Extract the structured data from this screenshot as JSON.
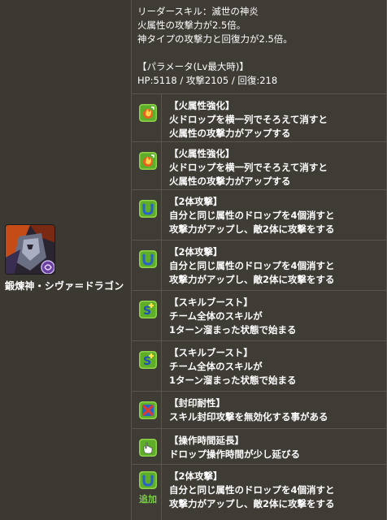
{
  "leader": {
    "lines": [
      "リーダースキル：滅世の神炎",
      "火属性の攻撃力が2.5倍。",
      "神タイプの攻撃力と回復力が2.5倍。",
      "",
      "【パラメータ(Lv最大時)】",
      "HP:5118 / 攻撃2105 / 回復:218"
    ]
  },
  "monster": {
    "name": "鍛煉神・シヴァ＝ドラゴン",
    "accent": "#c54c16"
  },
  "awakenings": [
    {
      "icon": "fire-enhance-icon",
      "title": "【火属性強化】",
      "lines": [
        "火ドロップを横一列でそろえて消すと",
        "火属性の攻撃力がアップする"
      ]
    },
    {
      "icon": "fire-enhance-icon",
      "title": "【火属性強化】",
      "lines": [
        "火ドロップを横一列でそろえて消すと",
        "火属性の攻撃力がアップする"
      ]
    },
    {
      "icon": "two-way-attack-icon",
      "title": "【2体攻撃】",
      "lines": [
        "自分と同じ属性のドロップを4個消すと",
        "攻撃力がアップし、敵2体に攻撃をする"
      ]
    },
    {
      "icon": "two-way-attack-icon",
      "title": "【2体攻撃】",
      "lines": [
        "自分と同じ属性のドロップを4個消すと",
        "攻撃力がアップし、敵2体に攻撃をする"
      ]
    },
    {
      "icon": "skill-boost-icon",
      "title": "【スキルブースト】",
      "lines": [
        "チーム全体のスキルが",
        "1ターン溜まった状態で始まる"
      ]
    },
    {
      "icon": "skill-boost-icon",
      "title": "【スキルブースト】",
      "lines": [
        "チーム全体のスキルが",
        "1ターン溜まった状態で始まる"
      ]
    },
    {
      "icon": "seal-resist-icon",
      "title": "【封印耐性】",
      "lines": [
        "スキル封印攻撃を無効化する事がある"
      ]
    },
    {
      "icon": "time-extend-icon",
      "title": "【操作時間延長】",
      "lines": [
        "ドロップ操作時間が少し延びる"
      ]
    },
    {
      "icon": "two-way-attack-icon",
      "title": "【2体攻撃】",
      "lines": [
        "自分と同じ属性のドロップを4個消すと",
        "攻撃力がアップし、敵2体に攻撃をする"
      ],
      "added_label": "追加"
    }
  ]
}
